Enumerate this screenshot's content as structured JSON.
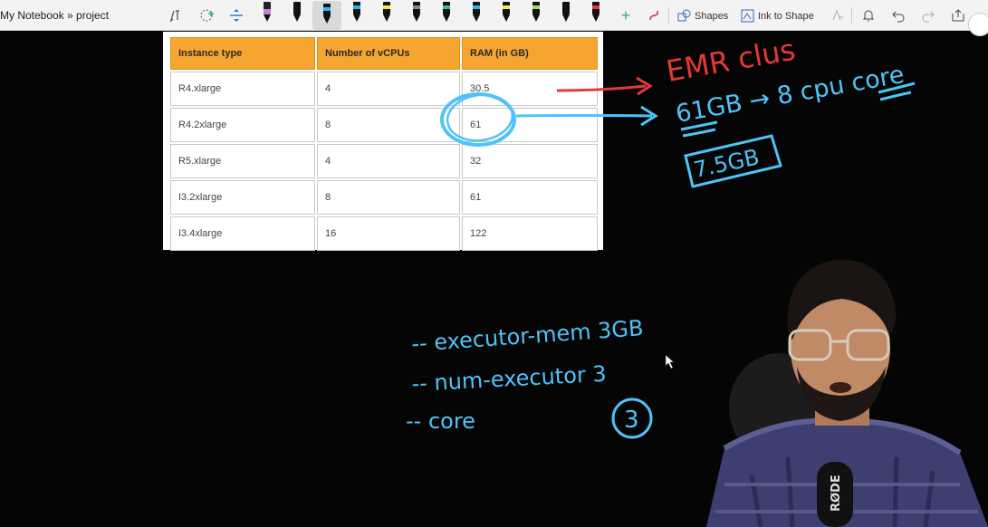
{
  "toolbar": {
    "breadcrumb": "My Notebook » project",
    "shapes_label": "Shapes",
    "ink_to_shape_label": "Ink to Shape",
    "pens": [
      {
        "color": "#c77dd6"
      },
      {
        "color": "#111111"
      },
      {
        "color": "#29b6f6"
      },
      {
        "color": "#29b6f6"
      },
      {
        "color": "#f5e942"
      },
      {
        "color": "#888888"
      },
      {
        "color": "#34c77b"
      },
      {
        "color": "#29b6f6"
      },
      {
        "color": "#f5e942"
      },
      {
        "color": "#9be15d"
      },
      {
        "color": "#111111"
      },
      {
        "color": "#e53935"
      }
    ]
  },
  "table": {
    "headers": [
      "Instance type",
      "Number of vCPUs",
      "RAM (in GB)"
    ],
    "rows": [
      [
        "R4.xlarge",
        "4",
        "30.5"
      ],
      [
        "R4.2xlarge",
        "8",
        "61"
      ],
      [
        "R5.xlarge",
        "4",
        "32"
      ],
      [
        "I3.2xlarge",
        "8",
        "61"
      ],
      [
        "I3.4xlarge",
        "16",
        "122"
      ]
    ]
  },
  "annotations": {
    "emr": "EMR clus",
    "gb_cpu": "61GB → 8 cpu core",
    "boxed": "7.5GB",
    "line1": "-- executor-mem 3GB",
    "line2": "-- num-executor 3",
    "line3": "-- core",
    "circled": "3"
  },
  "colors": {
    "ink_blue": "#4fc3f7",
    "ink_red": "#e53935",
    "header_orange": "#f7a531"
  },
  "logos": {
    "mic": "RØDE"
  }
}
